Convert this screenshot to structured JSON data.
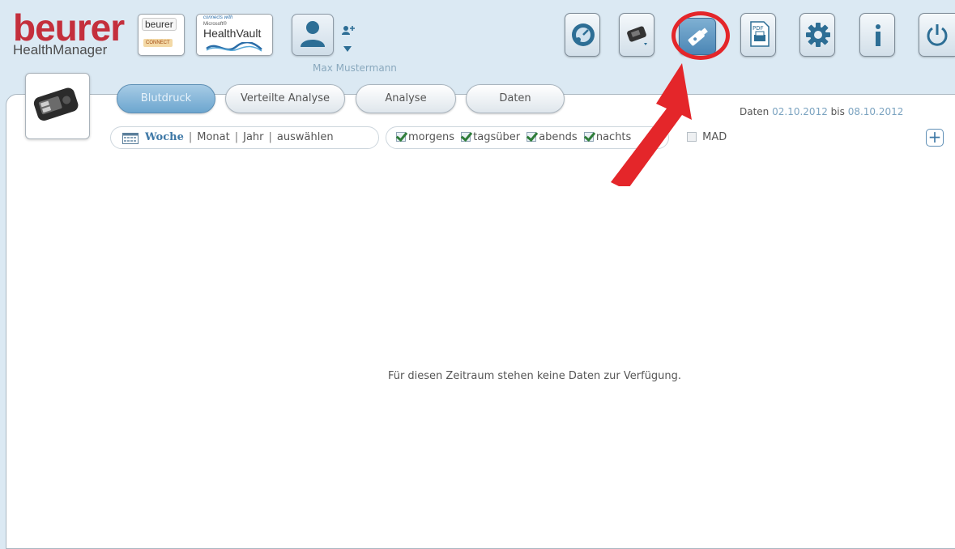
{
  "header": {
    "logo_main": "beurer",
    "logo_sub": "HealthManager",
    "connect_badge": {
      "top": "beurer",
      "bottom": "CONNECT"
    },
    "healthvault_badge": {
      "line1": "connects with",
      "line2": "Microsoft®",
      "line3": "HealthVault"
    },
    "user_name": "Max Mustermann"
  },
  "toolbar": {
    "buttons": [
      {
        "name": "measurement-device",
        "icon": "gauge-icon"
      },
      {
        "name": "device-select",
        "icon": "wrist-monitor-icon"
      },
      {
        "name": "usb-import",
        "icon": "usb-stick-icon",
        "highlighted": true
      },
      {
        "name": "pdf-export",
        "icon": "pdf-icon"
      },
      {
        "name": "settings",
        "icon": "gear-icon"
      },
      {
        "name": "info",
        "icon": "info-icon"
      },
      {
        "name": "power",
        "icon": "power-icon"
      }
    ],
    "highlight_color": "#e4262a"
  },
  "tabs": [
    {
      "label": "Blutdruck",
      "active": true
    },
    {
      "label": "Verteilte Analyse",
      "active": false
    },
    {
      "label": "Analyse",
      "active": false
    },
    {
      "label": "Daten",
      "active": false
    }
  ],
  "date_range": {
    "label": "Daten",
    "from": "02.10.2012",
    "sep": "bis",
    "to": "08.10.2012"
  },
  "period": {
    "items": [
      "Woche",
      "Monat",
      "Jahr",
      "auswählen"
    ],
    "selected": "Woche"
  },
  "day_filters": [
    {
      "label": "morgens",
      "checked": true
    },
    {
      "label": "tagsüber",
      "checked": true
    },
    {
      "label": "abends",
      "checked": true
    },
    {
      "label": "nachts",
      "checked": true
    }
  ],
  "mad": {
    "label": "MAD",
    "checked": false
  },
  "plus_label": "+",
  "empty_message": "Für diesen Zeitraum stehen keine Daten zur Verfügung.",
  "colors": {
    "brand_red": "#c42f3c",
    "accent_blue": "#3e78a6",
    "annotation_red": "#e4262a"
  }
}
